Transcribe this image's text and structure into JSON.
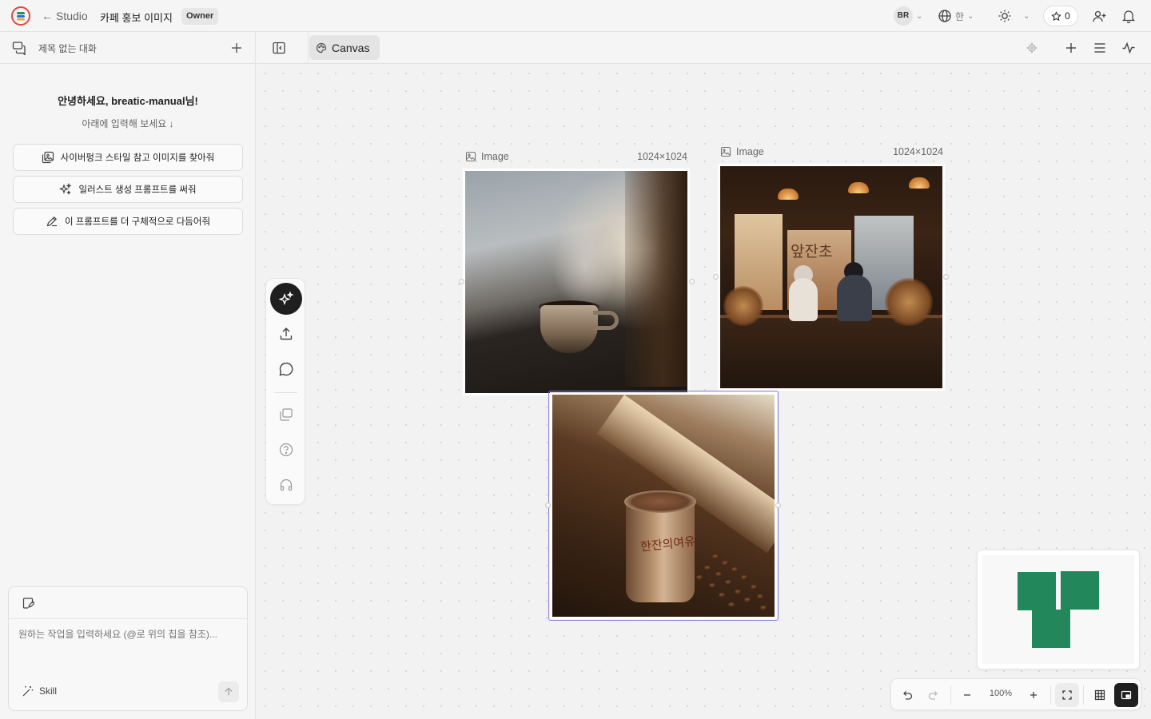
{
  "topbar": {
    "back_label": "Studio",
    "project_title": "카페 홍보 이미지",
    "role_badge": "Owner",
    "user_initials": "BR",
    "language": "한",
    "credits": "0"
  },
  "sidebar": {
    "conversation_title": "제목 없는 대화",
    "greeting": "안녕하세요, breatic-manual님!",
    "greeting_sub": "아래에 입력해 보세요 ↓",
    "suggestions": [
      {
        "label": "사이버펑크 스타일 참고 이미지를 찾아줘",
        "icon": "image-search-icon"
      },
      {
        "label": "일러스트 생성 프롬프트를 써줘",
        "icon": "sparkles-icon"
      },
      {
        "label": "이 프롬프트를 더 구체적으로 다듬어줘",
        "icon": "pencil-icon"
      }
    ],
    "composer": {
      "placeholder": "원하는 작업을 입력하세요 (@로 위의 칩을 참조)...",
      "skill_label": "Skill"
    }
  },
  "canvas_header": {
    "tab_label": "Canvas"
  },
  "canvas": {
    "nodes": [
      {
        "type_label": "Image",
        "size_label": "1024×1024",
        "alt": "steaming coffee cup on wooden table by window"
      },
      {
        "type_label": "Image",
        "size_label": "1024×1024",
        "alt": "warm cafe interior with customers at counter"
      },
      {
        "type_label": "Image",
        "size_label": "1024×1024",
        "alt": "paper coffee cup with beans on windowsill",
        "selected": true
      }
    ],
    "photo_texts": {
      "cafe_sign": "앞잔초",
      "cup_print": "한잔의여유"
    }
  },
  "zoom": {
    "level": "100%"
  },
  "colors": {
    "accent_selection": "#8b7fd8",
    "minimap_block": "#22875a",
    "active_tool": "#1f1f1f",
    "logo_red": "#e0453b"
  }
}
